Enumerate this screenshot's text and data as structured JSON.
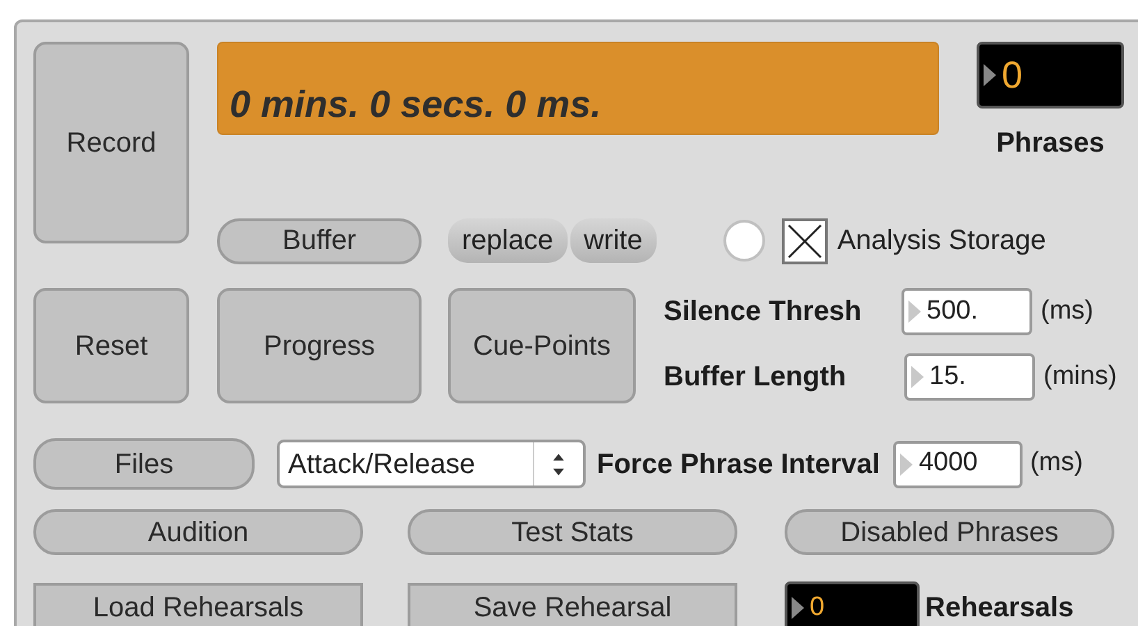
{
  "record_button": "Record",
  "timer": "0 mins. 0 secs. 0 ms.",
  "phrases_counter": {
    "value": "0",
    "label": "Phrases"
  },
  "buffer_button": "Buffer",
  "mode_buttons": [
    "replace",
    "write"
  ],
  "radio": {
    "on": false
  },
  "analysis_storage": {
    "checked": true,
    "label": "Analysis Storage"
  },
  "action_buttons": [
    "Reset",
    "Progress",
    "Cue-Points"
  ],
  "settings": [
    {
      "label": "Silence Thresh",
      "value": "500.",
      "unit": "(ms)"
    },
    {
      "label": "Buffer Length",
      "value": "15.",
      "unit": "(mins)"
    }
  ],
  "files_button": "Files",
  "mode_menu": {
    "value": "Attack/Release"
  },
  "force_phrase_interval": {
    "label": "Force Phrase Interval",
    "value": "4000",
    "unit": "(ms)"
  },
  "pill_buttons": [
    "Audition",
    "Test Stats",
    "Disabled Phrases"
  ],
  "rehearsal_buttons": [
    "Load Rehearsals",
    "Save Rehearsal"
  ],
  "rehearsals_counter": {
    "value": "0",
    "label": "Rehearsals"
  }
}
